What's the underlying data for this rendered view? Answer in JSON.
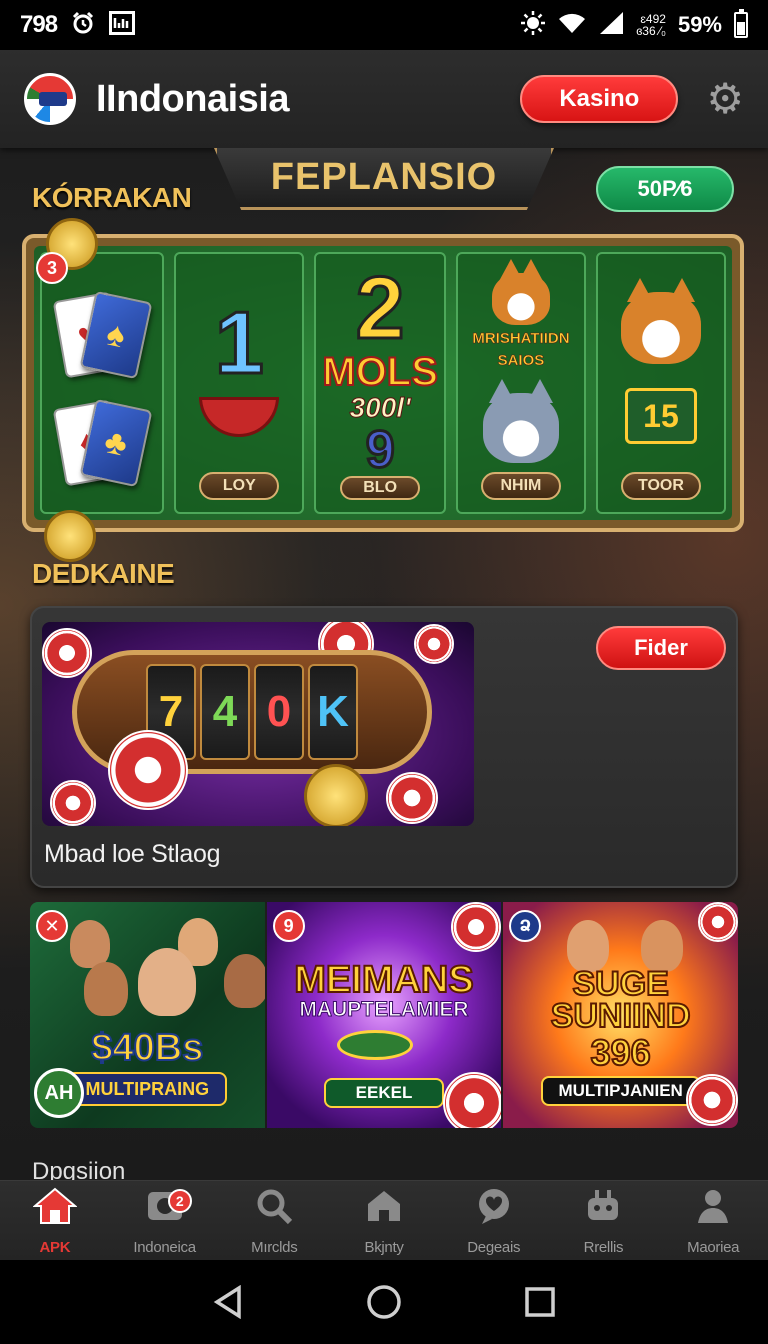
{
  "status_bar": {
    "time": "798",
    "carrier_small_line1": "ɛ492",
    "carrier_small_line2": "ɞ36 ⁄₀",
    "battery_percent": "59%",
    "battery_level": 0.59
  },
  "header": {
    "app_title": "IIndonaisia",
    "primary_button": "Kasino",
    "icons": [
      "logo-icon",
      "gear-icon"
    ]
  },
  "featured": {
    "banner_title": "FEPLANSIO",
    "section_label": "KÓRRAKAN",
    "percent_badge": "50P⁄6",
    "corner_badge": "3",
    "columns": [
      {
        "button": "LOY",
        "art": "cards-and-pot"
      },
      {
        "button": "BLO",
        "art_text": "MOLS",
        "big": "2",
        "sub": "300l'"
      },
      {
        "button": "NHIM",
        "caption_line1": "MRISHATIIDN",
        "caption_line2": "SAIOS"
      },
      {
        "button": "TOOR",
        "card_text": "15"
      }
    ],
    "first_number": "1",
    "nine": "9"
  },
  "promo": {
    "section_label": "DEDKAINE",
    "button": "Fider",
    "caption": "Mbad loe Stlaog",
    "reels": [
      "7",
      "4",
      "0",
      "K"
    ]
  },
  "tiles": [
    {
      "badge": "✕",
      "title": "$40Bs",
      "banner": "MULTIPRAING",
      "corner": "AH"
    },
    {
      "badge": "9",
      "title_line1": "MEIMANS",
      "title_line2": "MAUPTELAMIER",
      "banner": "EEKEL"
    },
    {
      "badge": "Ձ",
      "title_line1": "SUGE",
      "title_line2": "SUNIIND",
      "number": "396",
      "banner": "MULTIPJANIEN"
    }
  ],
  "bottom_section_label": "Dpgsiion",
  "bottom_nav": [
    {
      "label": "APK",
      "icon": "home-icon",
      "active": true
    },
    {
      "label": "Indoneica",
      "icon": "wallet-icon",
      "badge": "2"
    },
    {
      "label": "Mırclds",
      "icon": "search-icon"
    },
    {
      "label": "Bkjnty",
      "icon": "house-icon"
    },
    {
      "label": "Degeais",
      "icon": "chat-icon"
    },
    {
      "label": "Rrellis",
      "icon": "robot-icon"
    },
    {
      "label": "Maoriea",
      "icon": "person-icon"
    }
  ],
  "colors": {
    "accent_red": "#e53935",
    "gold": "#f0c15a",
    "green_badge": "#0f8a47"
  }
}
